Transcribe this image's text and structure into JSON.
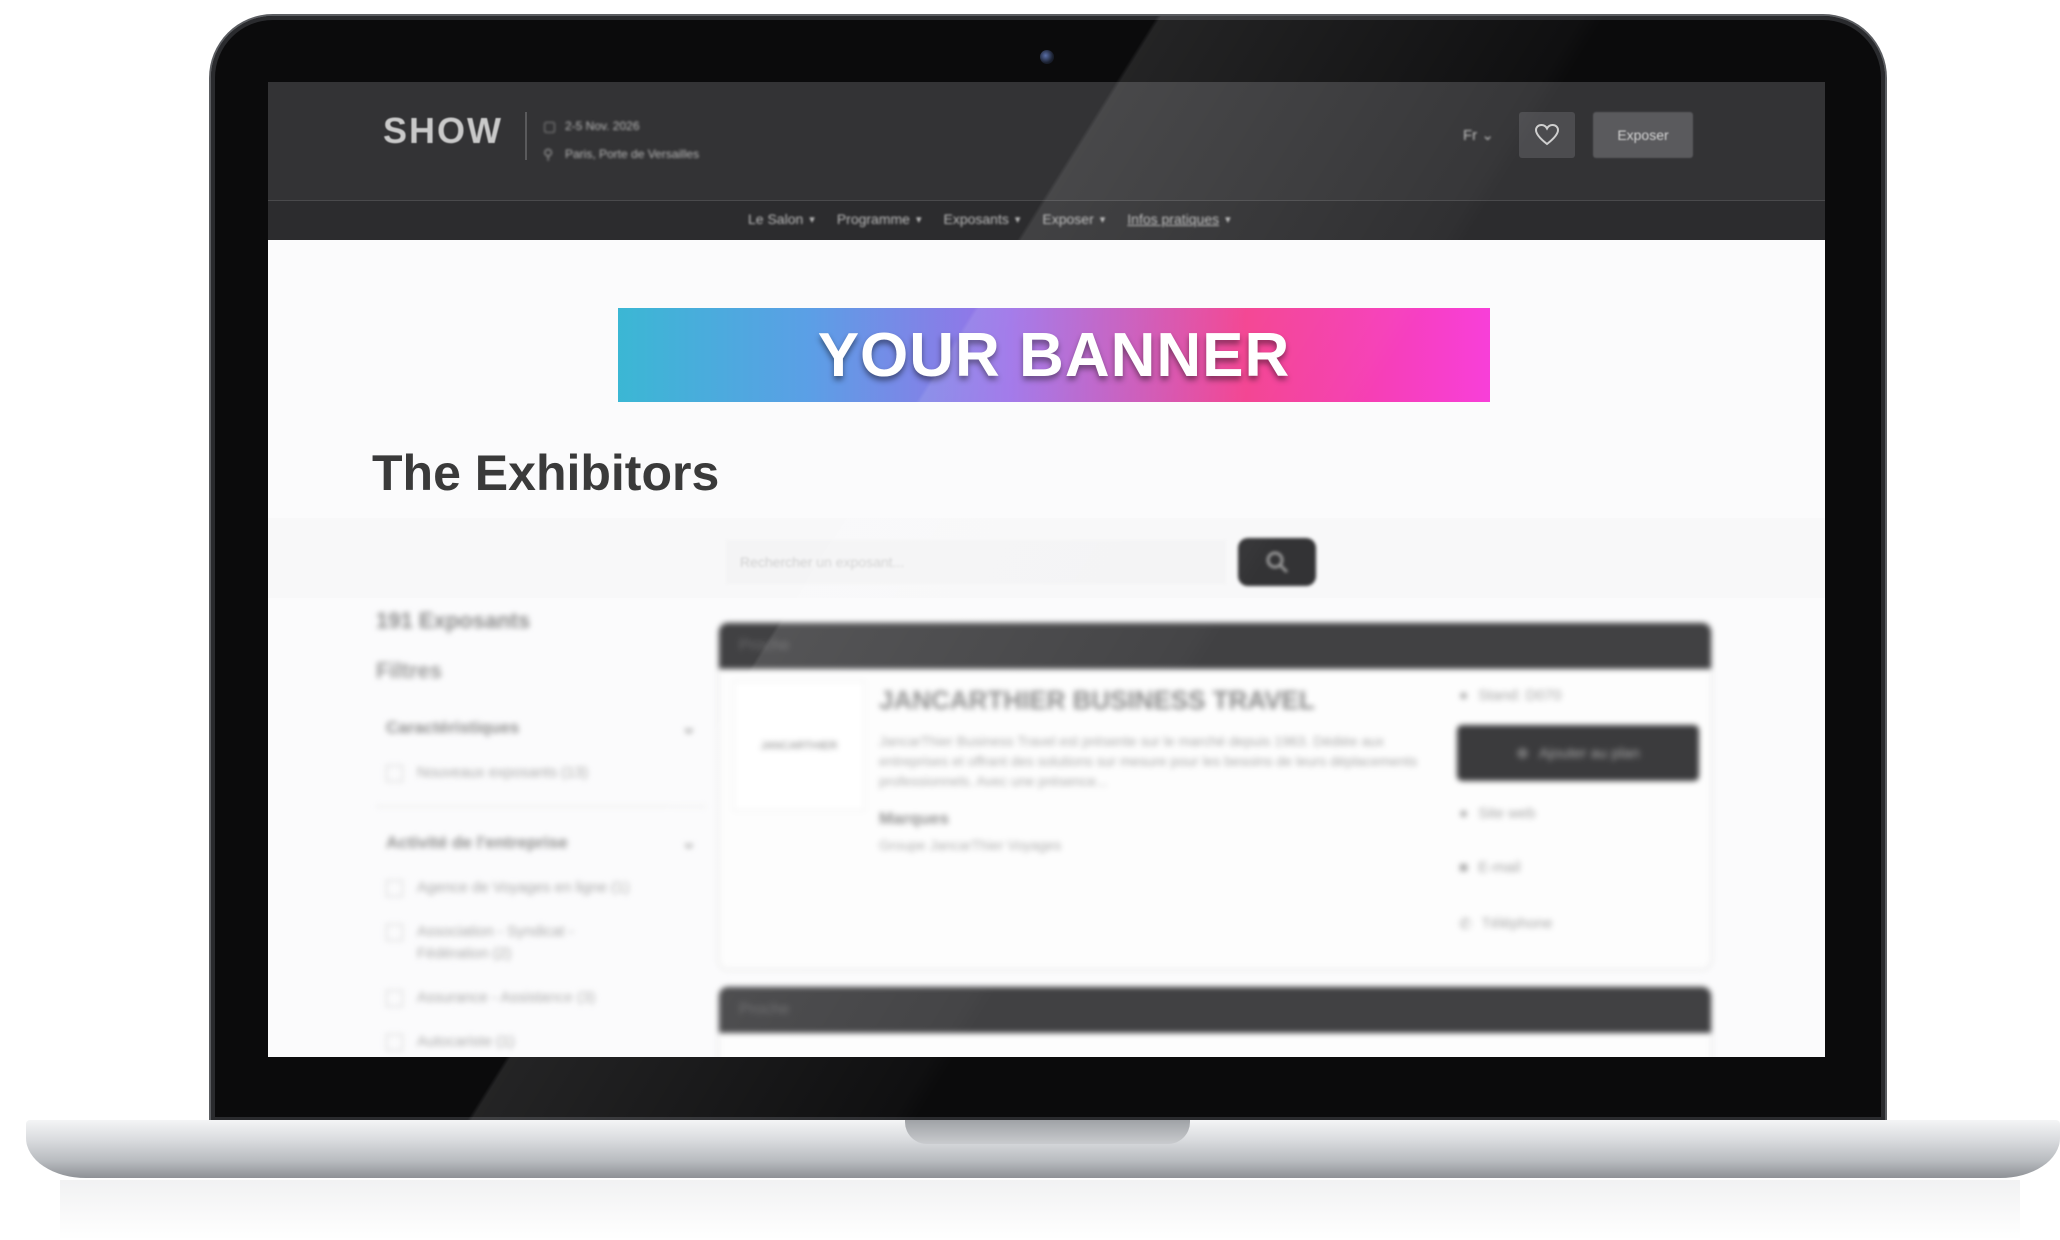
{
  "header": {
    "logo": "SHOW",
    "event_date": "2-5 Nov. 2026",
    "event_place": "Paris, Porte de Versailles",
    "language": "Fr",
    "expose_label": "Exposer"
  },
  "nav": {
    "items": [
      {
        "label": "Le Salon"
      },
      {
        "label": "Programme"
      },
      {
        "label": "Exposants"
      },
      {
        "label": "Exposer"
      },
      {
        "label": "Infos pratiques"
      }
    ]
  },
  "banner": {
    "text": "YOUR BANNER"
  },
  "page": {
    "title": "The Exhibitors"
  },
  "search": {
    "placeholder": "Rechercher un exposant..."
  },
  "sidebar": {
    "count": "191 Exposants",
    "filters_label": "Filtres",
    "groups": [
      {
        "title": "Caractéristiques",
        "options": [
          "Nouveaux exposants (13)"
        ]
      },
      {
        "title": "Activité de l'entreprise",
        "options": [
          "Agence de Voyages en ligne (1)",
          "Association - Syndicat - Fédération (2)",
          "Assurance - Assistance (3)",
          "Autocariste (1)"
        ]
      }
    ]
  },
  "cards": [
    {
      "header": "Proche",
      "logo_text": "JANCARTHIER",
      "title": "JANCARTHIER BUSINESS TRAVEL",
      "description": "JancarThier Business Travel est présente sur le marché depuis 1963. Dédiée aux entreprises et offrant des solutions sur mesure pour les besoins de leurs déplacements professionnels. Avec une présence...",
      "brands_label": "Marques",
      "brands_value": "Groupe JancarThier Voyages",
      "stand": "Stand: D070",
      "add_plan": "Ajouter au plan",
      "website": "Site web",
      "email": "E-mail",
      "phone": "Téléphone"
    },
    {
      "header": "Proche"
    }
  ]
}
